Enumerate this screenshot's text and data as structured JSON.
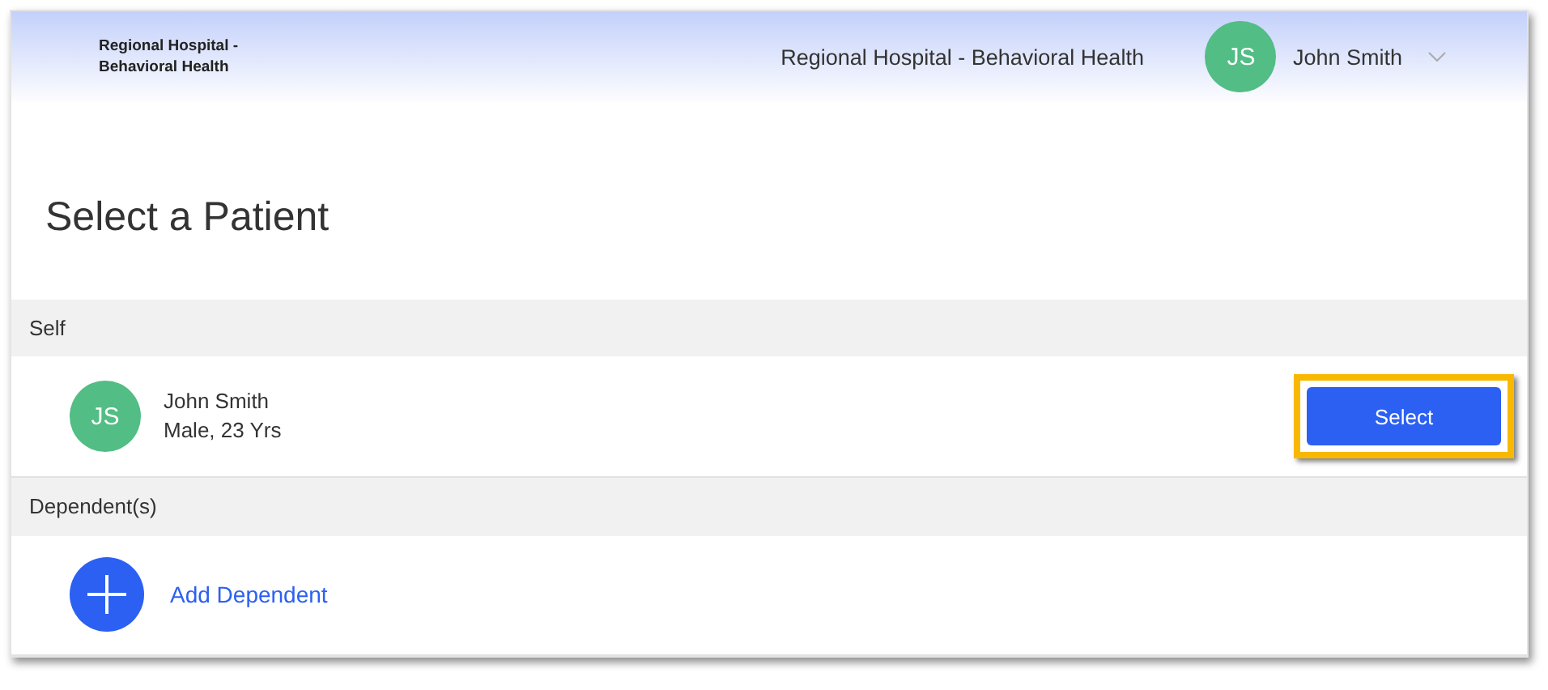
{
  "header": {
    "logo_text": "Regional Hospital - Behavioral Health",
    "facility": "Regional Hospital - Behavioral Health",
    "user": {
      "initials": "JS",
      "name": "John Smith"
    }
  },
  "page_title": "Select a Patient",
  "sections": [
    {
      "heading": "Self",
      "rows": [
        {
          "kind": "patient",
          "initials": "JS",
          "name": "John Smith",
          "details": "Male, 23 Yrs",
          "button": {
            "label": "Select",
            "highlighted": true
          }
        }
      ]
    },
    {
      "heading": "Dependent(s)",
      "rows": [
        {
          "kind": "add",
          "label": "Add Dependent"
        }
      ]
    }
  ]
}
